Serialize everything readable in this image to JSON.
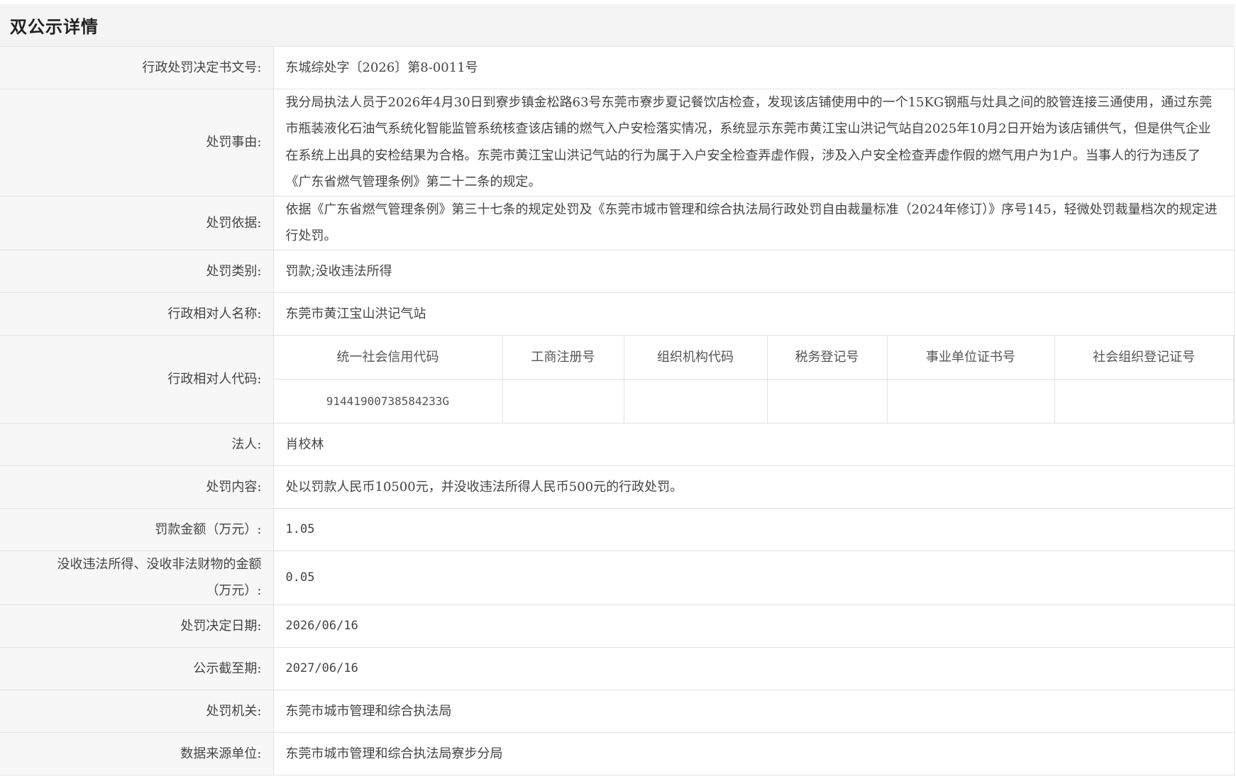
{
  "header": {
    "title": "双公示详情"
  },
  "rows": {
    "doc_no": {
      "label": "行政处罚决定书文号:",
      "value": "东城综处字〔2026〕第8-0011号"
    },
    "reason": {
      "label": "处罚事由:",
      "value": "我分局执法人员于2026年4月30日到寮步镇金松路63号东莞市寮步夏记餐饮店检查，发现该店铺使用中的一个15KG钢瓶与灶具之间的胶管连接三通使用，通过东莞市瓶装液化石油气系统化智能监管系统核查该店铺的燃气入户安检落实情况，系统显示东莞市黄江宝山洪记气站自2025年10月2日开始为该店铺供气，但是供气企业在系统上出具的安检结果为合格。东莞市黄江宝山洪记气站的行为属于入户安全检查弄虚作假，涉及入户安全检查弄虚作假的燃气用户为1户。当事人的行为违反了《广东省燃气管理条例》第二十二条的规定。"
    },
    "basis": {
      "label": "处罚依据:",
      "value": "依据《广东省燃气管理条例》第三十七条的规定处罚及《东莞市城市管理和综合执法局行政处罚自由裁量标准（2024年修订）》序号145，轻微处罚裁量档次的规定进行处罚。"
    },
    "category": {
      "label": "处罚类别:",
      "value": "罚款;没收违法所得"
    },
    "party_name": {
      "label": "行政相对人名称:",
      "value": "东莞市黄江宝山洪记气站"
    },
    "party_code": {
      "label": "行政相对人代码:",
      "columns": [
        "统一社会信用代码",
        "工商注册号",
        "组织机构代码",
        "税务登记号",
        "事业单位证书号",
        "社会组织登记证号"
      ],
      "values": [
        "91441900738584233G",
        "",
        "",
        "",
        "",
        ""
      ]
    },
    "legal_person": {
      "label": "法人:",
      "value": "肖校林"
    },
    "content": {
      "label": "处罚内容:",
      "value": "处以罚款人民币10500元，并没收违法所得人民币500元的行政处罚。"
    },
    "fine": {
      "label": "罚款金额（万元）:",
      "value": "1.05"
    },
    "confiscation": {
      "label": "没收违法所得、没收非法财物的金额（万元）:",
      "value": "0.05"
    },
    "decision_date": {
      "label": "处罚决定日期:",
      "value": "2026/06/16"
    },
    "publish_until": {
      "label": "公示截至期:",
      "value": "2027/06/16"
    },
    "authority": {
      "label": "处罚机关:",
      "value": "东莞市城市管理和综合执法局"
    },
    "source": {
      "label": "数据来源单位:",
      "value": "东莞市城市管理和综合执法局寮步分局"
    }
  }
}
